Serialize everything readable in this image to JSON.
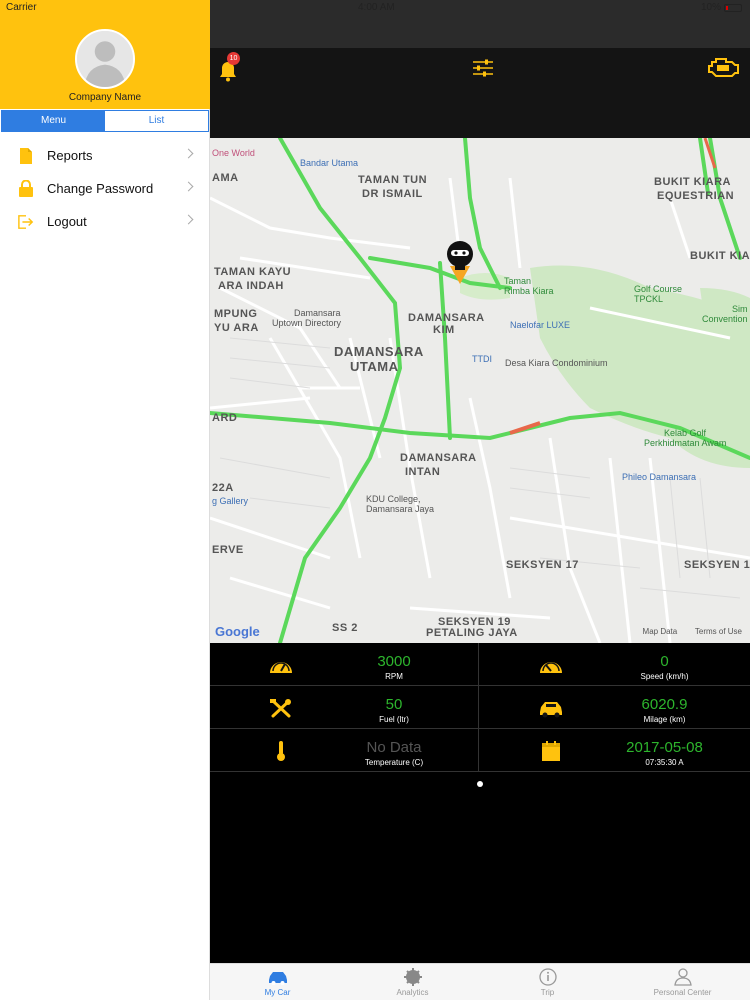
{
  "status": {
    "carrier": "Carrier",
    "time": "4:00 AM",
    "battery": "10%"
  },
  "sidebar": {
    "company": "Company Name",
    "segments": [
      "Menu",
      "List"
    ],
    "items": [
      {
        "label": "Reports",
        "icon": "document-icon"
      },
      {
        "label": "Change Password",
        "icon": "lock-icon"
      },
      {
        "label": "Logout",
        "icon": "logout-icon"
      }
    ]
  },
  "header": {
    "notifications": "10"
  },
  "map": {
    "labels": {
      "taman_tun": "TAMAN TUN",
      "dr_ismail": "DR ISMAIL",
      "bukit_kiara_equestrian1": "BUKIT KIARA",
      "bukit_kiara_equestrian2": "EQUESTRIAN",
      "bukit_kiara": "BUKIT KIA",
      "taman_kayu": "TAMAN KAYU",
      "ara_indah": "ARA INDAH",
      "mpung": "MPUNG",
      "yu_ara": "YU ARA",
      "damansara_kim1": "DAMANSARA",
      "damansara_kim2": "KIM",
      "damansara_utama1": "DAMANSARA",
      "damansara_utama2": "UTAMA",
      "damansara_intan1": "DAMANSARA",
      "damansara_intan2": "INTAN",
      "seksyen_17": "SEKSYEN 17",
      "seksyen": "SEKSYEN 1",
      "seksyen_19": "SEKSYEN 19",
      "petaling_jaya": "PETALING JAYA",
      "ss2": "SS 2",
      "ama": "AMA",
      "ard": "ARD",
      "erve": "ERVE",
      "a22": "22A"
    },
    "pois": {
      "bandar_utama": "Bandar Utama",
      "one_world": "One World",
      "uptown1": "Damansara",
      "uptown2": "Uptown Directory",
      "naelofar": "Naelofar LUXE",
      "ttdi": "TTDI",
      "desa_kiara": "Desa Kiara Condominium",
      "kdu1": "KDU College,",
      "kdu2": "Damansara Jaya",
      "phileo": "Phileo Damansara",
      "gallery": "g Gallery",
      "taman_rimba1": "Taman",
      "taman_rimba2": "Rimba Kiara",
      "golf_course1": "Golf Course",
      "golf_course2": "TPCKL",
      "kelab_golf1": "Kelab Golf",
      "kelab_golf2": "Perkhidmatan Awam",
      "sim1": "Sim",
      "sim2": "Convention"
    },
    "google": "Google",
    "map_data": "Map Data",
    "terms": "Terms of Use"
  },
  "stats": [
    [
      {
        "icon": "gauge-icon",
        "value": "3000",
        "caption": "RPM"
      },
      {
        "icon": "speedometer-icon",
        "value": "0",
        "caption": "Speed (km/h)"
      }
    ],
    [
      {
        "icon": "tools-icon",
        "value": "50",
        "caption": "Fuel (ltr)"
      },
      {
        "icon": "car-icon",
        "value": "6020.9",
        "caption": "Milage (km)"
      }
    ],
    [
      {
        "icon": "thermometer-icon",
        "value": "No Data",
        "caption": "Temperature (C)"
      },
      {
        "icon": "calendar-icon",
        "value": "2017-05-08",
        "caption": "07:35:30 A"
      }
    ]
  ],
  "tabs": [
    {
      "label": "My Car",
      "active": true
    },
    {
      "label": "Analytics",
      "active": false
    },
    {
      "label": "Trip",
      "active": false
    },
    {
      "label": "Personal Center",
      "active": false
    }
  ],
  "colors": {
    "accent": "#ffc20e",
    "value_green": "#2db52d",
    "tab_active": "#2f7de1"
  }
}
